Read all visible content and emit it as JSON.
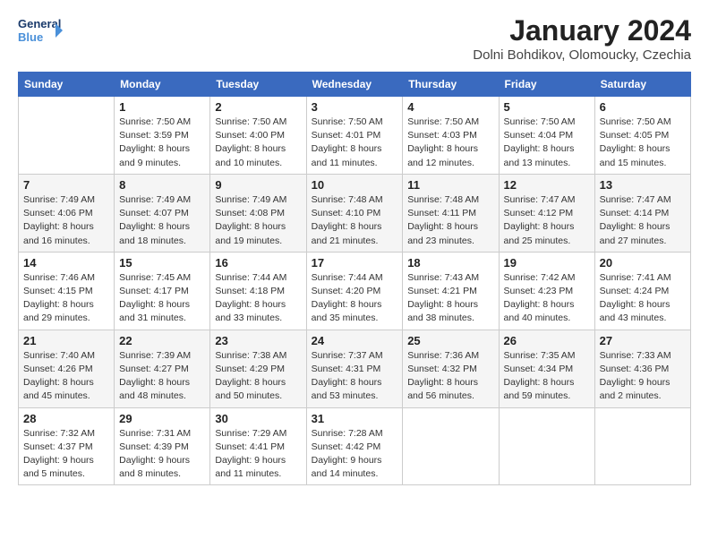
{
  "logo": {
    "line1": "General",
    "line2": "Blue"
  },
  "title": "January 2024",
  "subtitle": "Dolni Bohdikov, Olomoucky, Czechia",
  "headers": [
    "Sunday",
    "Monday",
    "Tuesday",
    "Wednesday",
    "Thursday",
    "Friday",
    "Saturday"
  ],
  "weeks": [
    [
      {
        "day": "",
        "sunrise": "",
        "sunset": "",
        "daylight": ""
      },
      {
        "day": "1",
        "sunrise": "Sunrise: 7:50 AM",
        "sunset": "Sunset: 3:59 PM",
        "daylight": "Daylight: 8 hours and 9 minutes."
      },
      {
        "day": "2",
        "sunrise": "Sunrise: 7:50 AM",
        "sunset": "Sunset: 4:00 PM",
        "daylight": "Daylight: 8 hours and 10 minutes."
      },
      {
        "day": "3",
        "sunrise": "Sunrise: 7:50 AM",
        "sunset": "Sunset: 4:01 PM",
        "daylight": "Daylight: 8 hours and 11 minutes."
      },
      {
        "day": "4",
        "sunrise": "Sunrise: 7:50 AM",
        "sunset": "Sunset: 4:03 PM",
        "daylight": "Daylight: 8 hours and 12 minutes."
      },
      {
        "day": "5",
        "sunrise": "Sunrise: 7:50 AM",
        "sunset": "Sunset: 4:04 PM",
        "daylight": "Daylight: 8 hours and 13 minutes."
      },
      {
        "day": "6",
        "sunrise": "Sunrise: 7:50 AM",
        "sunset": "Sunset: 4:05 PM",
        "daylight": "Daylight: 8 hours and 15 minutes."
      }
    ],
    [
      {
        "day": "7",
        "sunrise": "Sunrise: 7:49 AM",
        "sunset": "Sunset: 4:06 PM",
        "daylight": "Daylight: 8 hours and 16 minutes."
      },
      {
        "day": "8",
        "sunrise": "Sunrise: 7:49 AM",
        "sunset": "Sunset: 4:07 PM",
        "daylight": "Daylight: 8 hours and 18 minutes."
      },
      {
        "day": "9",
        "sunrise": "Sunrise: 7:49 AM",
        "sunset": "Sunset: 4:08 PM",
        "daylight": "Daylight: 8 hours and 19 minutes."
      },
      {
        "day": "10",
        "sunrise": "Sunrise: 7:48 AM",
        "sunset": "Sunset: 4:10 PM",
        "daylight": "Daylight: 8 hours and 21 minutes."
      },
      {
        "day": "11",
        "sunrise": "Sunrise: 7:48 AM",
        "sunset": "Sunset: 4:11 PM",
        "daylight": "Daylight: 8 hours and 23 minutes."
      },
      {
        "day": "12",
        "sunrise": "Sunrise: 7:47 AM",
        "sunset": "Sunset: 4:12 PM",
        "daylight": "Daylight: 8 hours and 25 minutes."
      },
      {
        "day": "13",
        "sunrise": "Sunrise: 7:47 AM",
        "sunset": "Sunset: 4:14 PM",
        "daylight": "Daylight: 8 hours and 27 minutes."
      }
    ],
    [
      {
        "day": "14",
        "sunrise": "Sunrise: 7:46 AM",
        "sunset": "Sunset: 4:15 PM",
        "daylight": "Daylight: 8 hours and 29 minutes."
      },
      {
        "day": "15",
        "sunrise": "Sunrise: 7:45 AM",
        "sunset": "Sunset: 4:17 PM",
        "daylight": "Daylight: 8 hours and 31 minutes."
      },
      {
        "day": "16",
        "sunrise": "Sunrise: 7:44 AM",
        "sunset": "Sunset: 4:18 PM",
        "daylight": "Daylight: 8 hours and 33 minutes."
      },
      {
        "day": "17",
        "sunrise": "Sunrise: 7:44 AM",
        "sunset": "Sunset: 4:20 PM",
        "daylight": "Daylight: 8 hours and 35 minutes."
      },
      {
        "day": "18",
        "sunrise": "Sunrise: 7:43 AM",
        "sunset": "Sunset: 4:21 PM",
        "daylight": "Daylight: 8 hours and 38 minutes."
      },
      {
        "day": "19",
        "sunrise": "Sunrise: 7:42 AM",
        "sunset": "Sunset: 4:23 PM",
        "daylight": "Daylight: 8 hours and 40 minutes."
      },
      {
        "day": "20",
        "sunrise": "Sunrise: 7:41 AM",
        "sunset": "Sunset: 4:24 PM",
        "daylight": "Daylight: 8 hours and 43 minutes."
      }
    ],
    [
      {
        "day": "21",
        "sunrise": "Sunrise: 7:40 AM",
        "sunset": "Sunset: 4:26 PM",
        "daylight": "Daylight: 8 hours and 45 minutes."
      },
      {
        "day": "22",
        "sunrise": "Sunrise: 7:39 AM",
        "sunset": "Sunset: 4:27 PM",
        "daylight": "Daylight: 8 hours and 48 minutes."
      },
      {
        "day": "23",
        "sunrise": "Sunrise: 7:38 AM",
        "sunset": "Sunset: 4:29 PM",
        "daylight": "Daylight: 8 hours and 50 minutes."
      },
      {
        "day": "24",
        "sunrise": "Sunrise: 7:37 AM",
        "sunset": "Sunset: 4:31 PM",
        "daylight": "Daylight: 8 hours and 53 minutes."
      },
      {
        "day": "25",
        "sunrise": "Sunrise: 7:36 AM",
        "sunset": "Sunset: 4:32 PM",
        "daylight": "Daylight: 8 hours and 56 minutes."
      },
      {
        "day": "26",
        "sunrise": "Sunrise: 7:35 AM",
        "sunset": "Sunset: 4:34 PM",
        "daylight": "Daylight: 8 hours and 59 minutes."
      },
      {
        "day": "27",
        "sunrise": "Sunrise: 7:33 AM",
        "sunset": "Sunset: 4:36 PM",
        "daylight": "Daylight: 9 hours and 2 minutes."
      }
    ],
    [
      {
        "day": "28",
        "sunrise": "Sunrise: 7:32 AM",
        "sunset": "Sunset: 4:37 PM",
        "daylight": "Daylight: 9 hours and 5 minutes."
      },
      {
        "day": "29",
        "sunrise": "Sunrise: 7:31 AM",
        "sunset": "Sunset: 4:39 PM",
        "daylight": "Daylight: 9 hours and 8 minutes."
      },
      {
        "day": "30",
        "sunrise": "Sunrise: 7:29 AM",
        "sunset": "Sunset: 4:41 PM",
        "daylight": "Daylight: 9 hours and 11 minutes."
      },
      {
        "day": "31",
        "sunrise": "Sunrise: 7:28 AM",
        "sunset": "Sunset: 4:42 PM",
        "daylight": "Daylight: 9 hours and 14 minutes."
      },
      {
        "day": "",
        "sunrise": "",
        "sunset": "",
        "daylight": ""
      },
      {
        "day": "",
        "sunrise": "",
        "sunset": "",
        "daylight": ""
      },
      {
        "day": "",
        "sunrise": "",
        "sunset": "",
        "daylight": ""
      }
    ]
  ]
}
